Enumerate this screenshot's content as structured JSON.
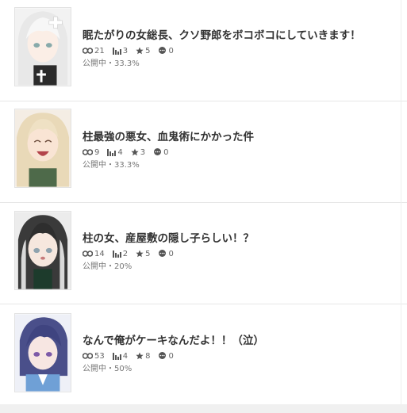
{
  "items": [
    {
      "title": "眠たがりの女総長、クソ野郎をボコボコにしていきます！",
      "views": "21",
      "rank": "3",
      "stars": "5",
      "comments": "0",
      "status": "公開中・33.3%"
    },
    {
      "title": "柱最強の悪女、血鬼術にかかった件",
      "views": "9",
      "rank": "4",
      "stars": "3",
      "comments": "0",
      "status": "公開中・33.3%"
    },
    {
      "title": "柱の女、産屋敷の隠し子らしい！？",
      "views": "14",
      "rank": "2",
      "stars": "5",
      "comments": "0",
      "status": "公開中・20%"
    },
    {
      "title": "なんで俺がケーキなんだよ！！（泣）",
      "views": "53",
      "rank": "4",
      "stars": "8",
      "comments": "0",
      "status": "公開中・50%"
    }
  ],
  "icons": {
    "views": "eye-icon",
    "rank": "ranking-bars-icon",
    "stars": "star-icon",
    "comments": "comment-icon"
  },
  "colors": {
    "icon": "#555555",
    "divider": "#e6e6e6"
  }
}
